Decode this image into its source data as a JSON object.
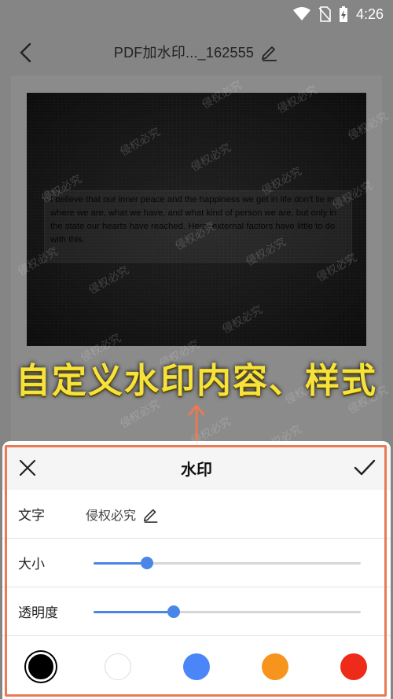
{
  "status_bar": {
    "time": "4:26",
    "icons": [
      "wifi-icon",
      "no-sim-icon",
      "battery-charging-icon"
    ]
  },
  "top_bar": {
    "title": "PDF加水印..._162555",
    "back_icon": "chevron-left-icon",
    "edit_icon": "pencil-icon"
  },
  "document": {
    "body_text": "I believe that our inner peace and the happiness we get in life don't lie in where we are, what we have, and what kind of person we are, but only in the state our hearts have reached. Here, external factors have little to do with this."
  },
  "watermark_text": "侵权必究",
  "promo": {
    "caption": "自定义水印内容、样式",
    "arrow_color": "#e97a52"
  },
  "sheet": {
    "title": "水印",
    "close_icon": "close-icon",
    "confirm_icon": "check-icon",
    "text_row": {
      "label": "文字",
      "value": "侵权必究"
    },
    "size_row": {
      "label": "大小",
      "value": 0.2
    },
    "opacity_row": {
      "label": "透明度",
      "value": 0.3
    },
    "colors": [
      {
        "name": "black",
        "hex": "#000000",
        "selected": true
      },
      {
        "name": "white",
        "hex": "#ffffff",
        "selected": false
      },
      {
        "name": "blue",
        "hex": "#4a86f7",
        "selected": false
      },
      {
        "name": "orange",
        "hex": "#f7941d",
        "selected": false
      },
      {
        "name": "red",
        "hex": "#ee2a1a",
        "selected": false
      }
    ],
    "accent_color": "#4a86e8",
    "highlight_border": "#e97a52"
  }
}
